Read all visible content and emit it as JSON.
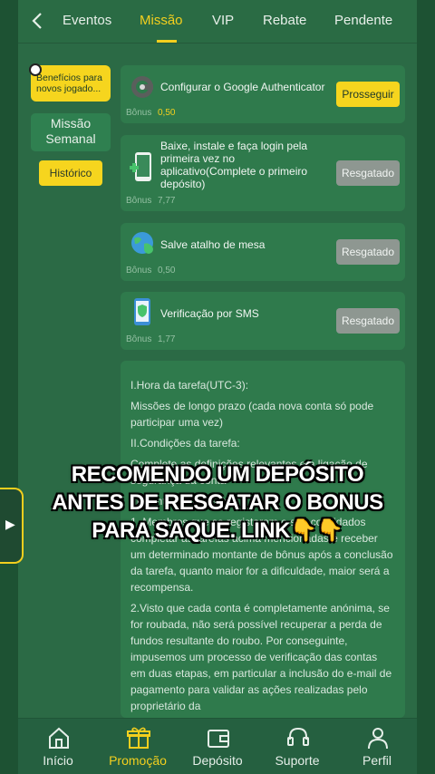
{
  "nav": {
    "back": "‹",
    "tabs": [
      "Eventos",
      "Missão",
      "VIP",
      "Rebate",
      "Pendente"
    ],
    "active_tab": 1
  },
  "sidebar": {
    "promo_badge": "Benefícios para novos jogado...",
    "mission_label": "Missão Semanal",
    "historico": "Histórico"
  },
  "tasks": [
    {
      "title": "Configurar o Google Authenticator",
      "bonus_label": "Bônus",
      "bonus": "0,50",
      "action": "Prosseguir",
      "icon": "google-authenticator-icon"
    },
    {
      "title": "Baixe, instale e faça login pela primeira vez no aplicativo(Complete o primeiro depósito)",
      "bonus_label": "Bônus",
      "bonus": "7,77",
      "action": "Resgatado",
      "icon": "phone-download-icon"
    },
    {
      "title": "Salve atalho de mesa",
      "bonus_label": "Bônus",
      "bonus": "0,50",
      "action": "Resgatado",
      "icon": "globe-icon"
    },
    {
      "title": "Verificação por SMS",
      "bonus_label": "Bônus",
      "bonus": "1,77",
      "action": "Resgatado",
      "icon": "phone-shield-icon"
    }
  ],
  "rules": {
    "p1": "I.Hora da tarefa(UTC-3):",
    "p2": "Missões de longo prazo (cada nova conta só pode participar uma vez)",
    "p3": "II.Condições da tarefa:",
    "p4": "Complete as definições relevantes e a ligação de segurança da conta",
    "p5": "III.Conteúdo da tarefa:",
    "p6": "1. Membros que se registaram e são convidados completar as tarefas acima mencionadas e receber um determinado montante de bônus após a conclusão da tarefa, quanto maior for a dificuldade, maior será a recompensa.",
    "p7": "2.Visto que cada conta é completamente anónima, se for roubada, não será possível recuperar a perda de fundos resultante do roubo. Por conseguinte, impusemos um processo de verificação das contas em duas etapas, em particular a inclusão do e-mail de pagamento para validar as ações realizadas pelo proprietário da"
  },
  "caption": "RECOMENDO UM DEPÓSITO ANTES DE RESGATAR O BONUS PARA SAQUE. LINK👇👇",
  "bottom_nav": [
    "Início",
    "Promoção",
    "Depósito",
    "Suporte",
    "Perfil"
  ],
  "bottom_active": 1,
  "colors": {
    "accent": "#f3cf1e",
    "background": "#2b6a45",
    "card": "#2f7a4c"
  }
}
